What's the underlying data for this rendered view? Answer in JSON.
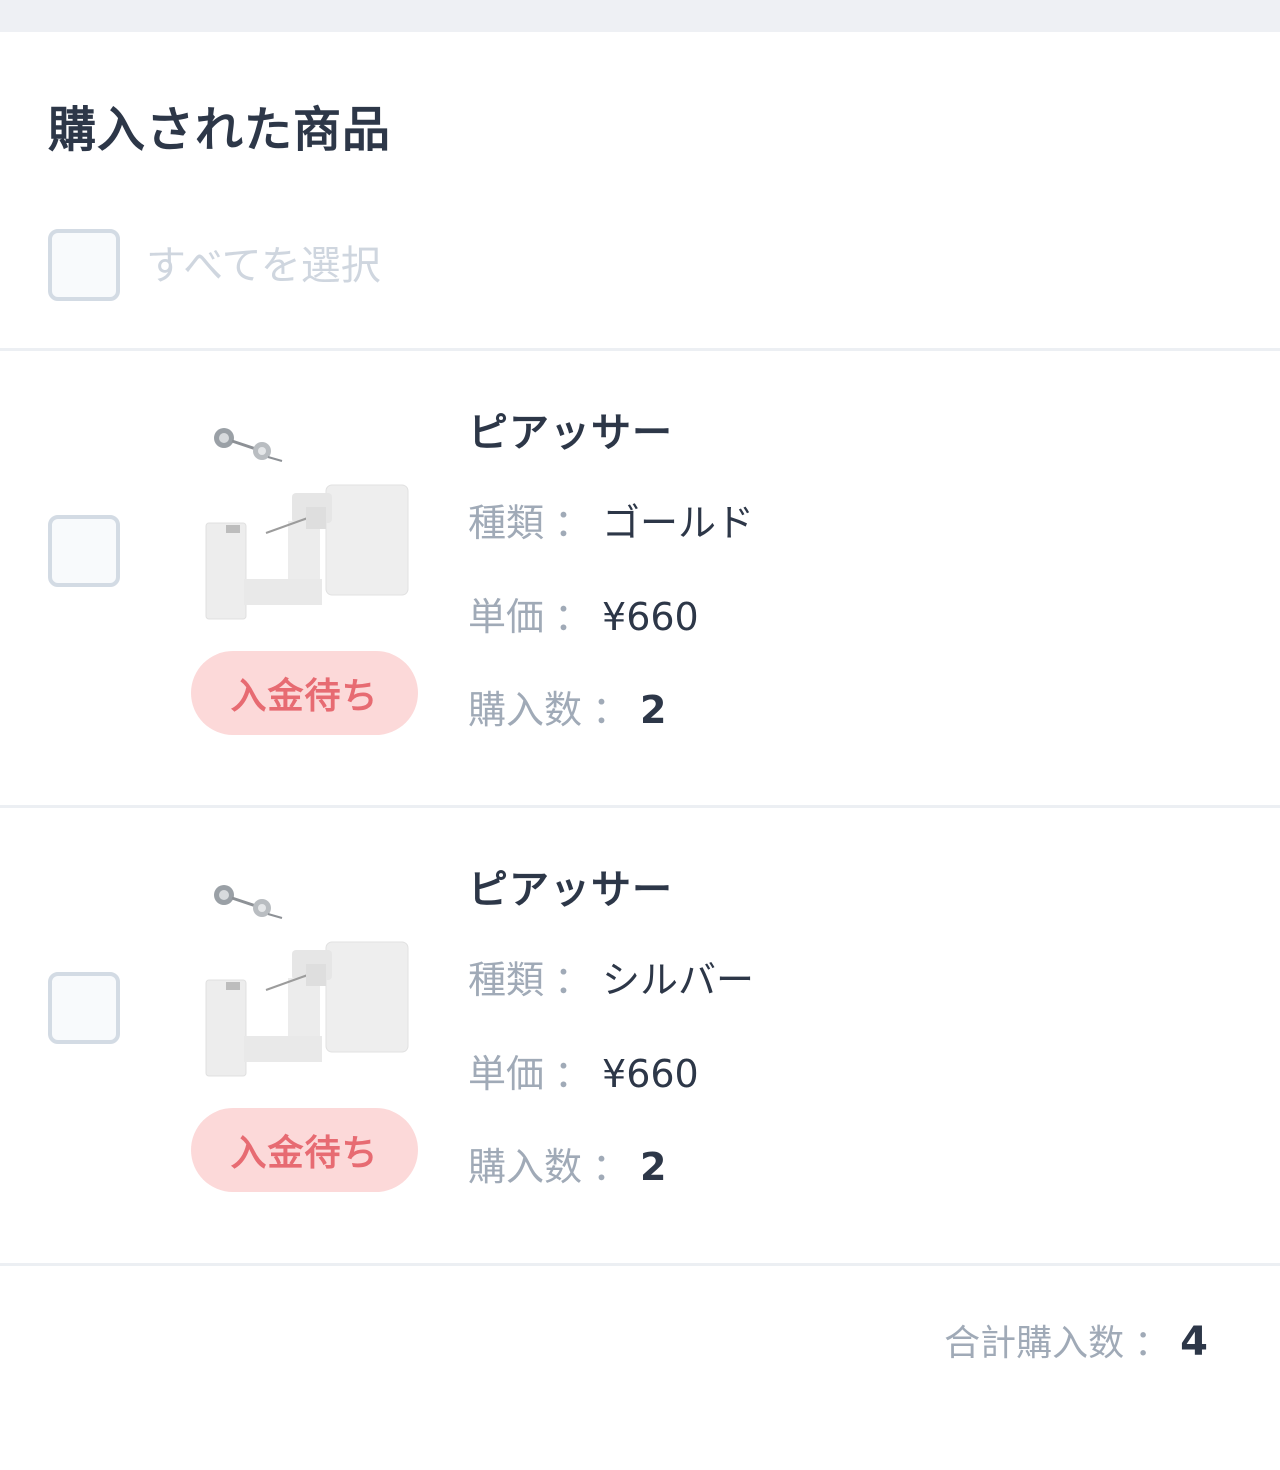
{
  "header": {
    "title": "購入された商品"
  },
  "select_all": {
    "label": "すべてを選択",
    "checked": false
  },
  "items": [
    {
      "name": "ピアッサー",
      "image_icon": "ear-piercer-image",
      "status": "入金待ち",
      "checked": false,
      "type_label": "種類",
      "type_value": "ゴールド",
      "price_label": "単価",
      "price_value": "¥660",
      "qty_label": "購入数",
      "qty_value": "2"
    },
    {
      "name": "ピアッサー",
      "image_icon": "ear-piercer-image",
      "status": "入金待ち",
      "checked": false,
      "type_label": "種類",
      "type_value": "シルバー",
      "price_label": "単価",
      "price_value": "¥660",
      "qty_label": "購入数",
      "qty_value": "2"
    }
  ],
  "separator": "：",
  "summary": {
    "total_label": "合計購入数",
    "total_value": "4"
  },
  "colors": {
    "title": "#2d3748",
    "muted": "#a0aab7",
    "status_bg": "#fcd9d9",
    "status_text": "#e76b72",
    "checkbox_border": "#d3dbe4"
  }
}
